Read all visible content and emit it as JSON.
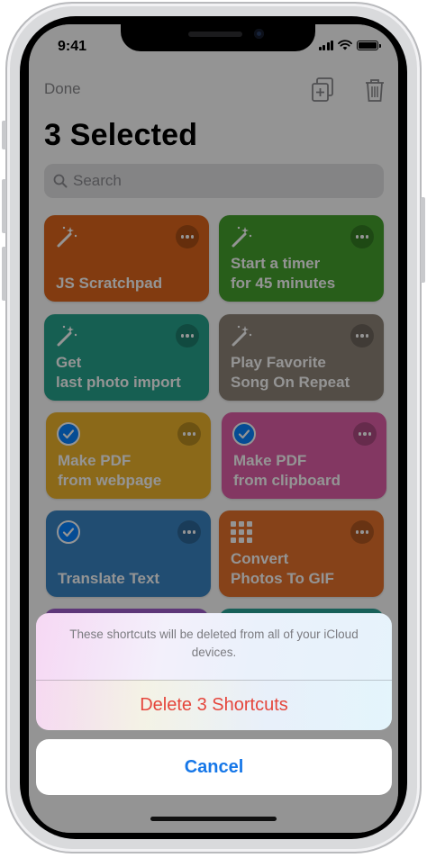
{
  "status_bar": {
    "time": "9:41"
  },
  "nav": {
    "done_label": "Done",
    "title": "3 Selected",
    "duplicate_icon": "duplicate-icon",
    "trash_icon": "trash-icon"
  },
  "search": {
    "placeholder": "Search"
  },
  "shortcuts": [
    {
      "line1": "JS Scratchpad",
      "line2": "",
      "color": "#e0671c",
      "icon": "magic-wand-icon",
      "selected": false
    },
    {
      "line1": "Start a timer",
      "line2": "for 45 minutes",
      "color": "#45a22e",
      "icon": "magic-wand-icon",
      "selected": false
    },
    {
      "line1": "Get",
      "line2": "last photo import",
      "color": "#27a48d",
      "icon": "magic-wand-icon",
      "selected": false
    },
    {
      "line1": "Play Favorite",
      "line2": "Song On Repeat",
      "color": "#8f8579",
      "icon": "magic-wand-icon",
      "selected": false
    },
    {
      "line1": "Make PDF",
      "line2": "from webpage",
      "color": "#f0b52b",
      "icon": "checkmark-icon",
      "selected": true
    },
    {
      "line1": "Make PDF",
      "line2": "from clipboard",
      "color": "#e25fa9",
      "icon": "checkmark-icon",
      "selected": true
    },
    {
      "line1": "Translate Text",
      "line2": "",
      "color": "#3a86c5",
      "icon": "checkmark-icon",
      "selected": true
    },
    {
      "line1": "Convert",
      "line2": "Photos To GIF",
      "color": "#e7732b",
      "icon": "grid-icon",
      "selected": false
    }
  ],
  "action_sheet": {
    "message": "These shortcuts will be deleted from all of your iCloud devices.",
    "destructive_label": "Delete 3 Shortcuts",
    "cancel_label": "Cancel"
  }
}
